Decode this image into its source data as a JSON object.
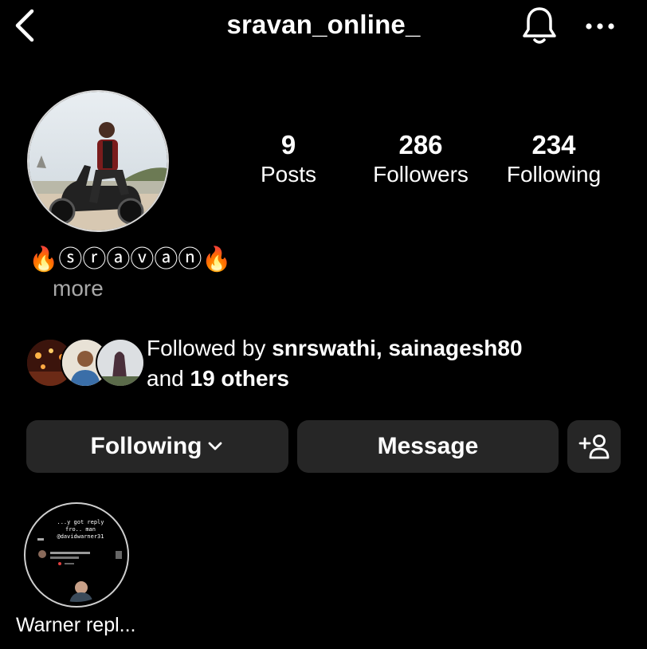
{
  "header": {
    "username": "sravan_online_"
  },
  "stats": {
    "posts": {
      "value": "9",
      "label": "Posts"
    },
    "followers": {
      "value": "286",
      "label": "Followers"
    },
    "following": {
      "value": "234",
      "label": "Following"
    }
  },
  "bio": {
    "text": "🔥ⓢⓡⓐⓥⓐⓝ🔥",
    "more": "more"
  },
  "mutual": {
    "prefix": "Followed by ",
    "names": "snrswathi, sainagesh80",
    "and": "and ",
    "others": "19 others"
  },
  "actions": {
    "following": "Following",
    "message": "Message"
  },
  "highlight": {
    "label": "Warner repl...",
    "thumb_text": "...y got reply fro.. man @davidwarner31"
  },
  "icons": {
    "back": "chevron-left-icon",
    "bell": "bell-icon",
    "more": "more-horizontal-icon",
    "dropdown": "chevron-down-icon",
    "add_user": "add-user-icon"
  }
}
